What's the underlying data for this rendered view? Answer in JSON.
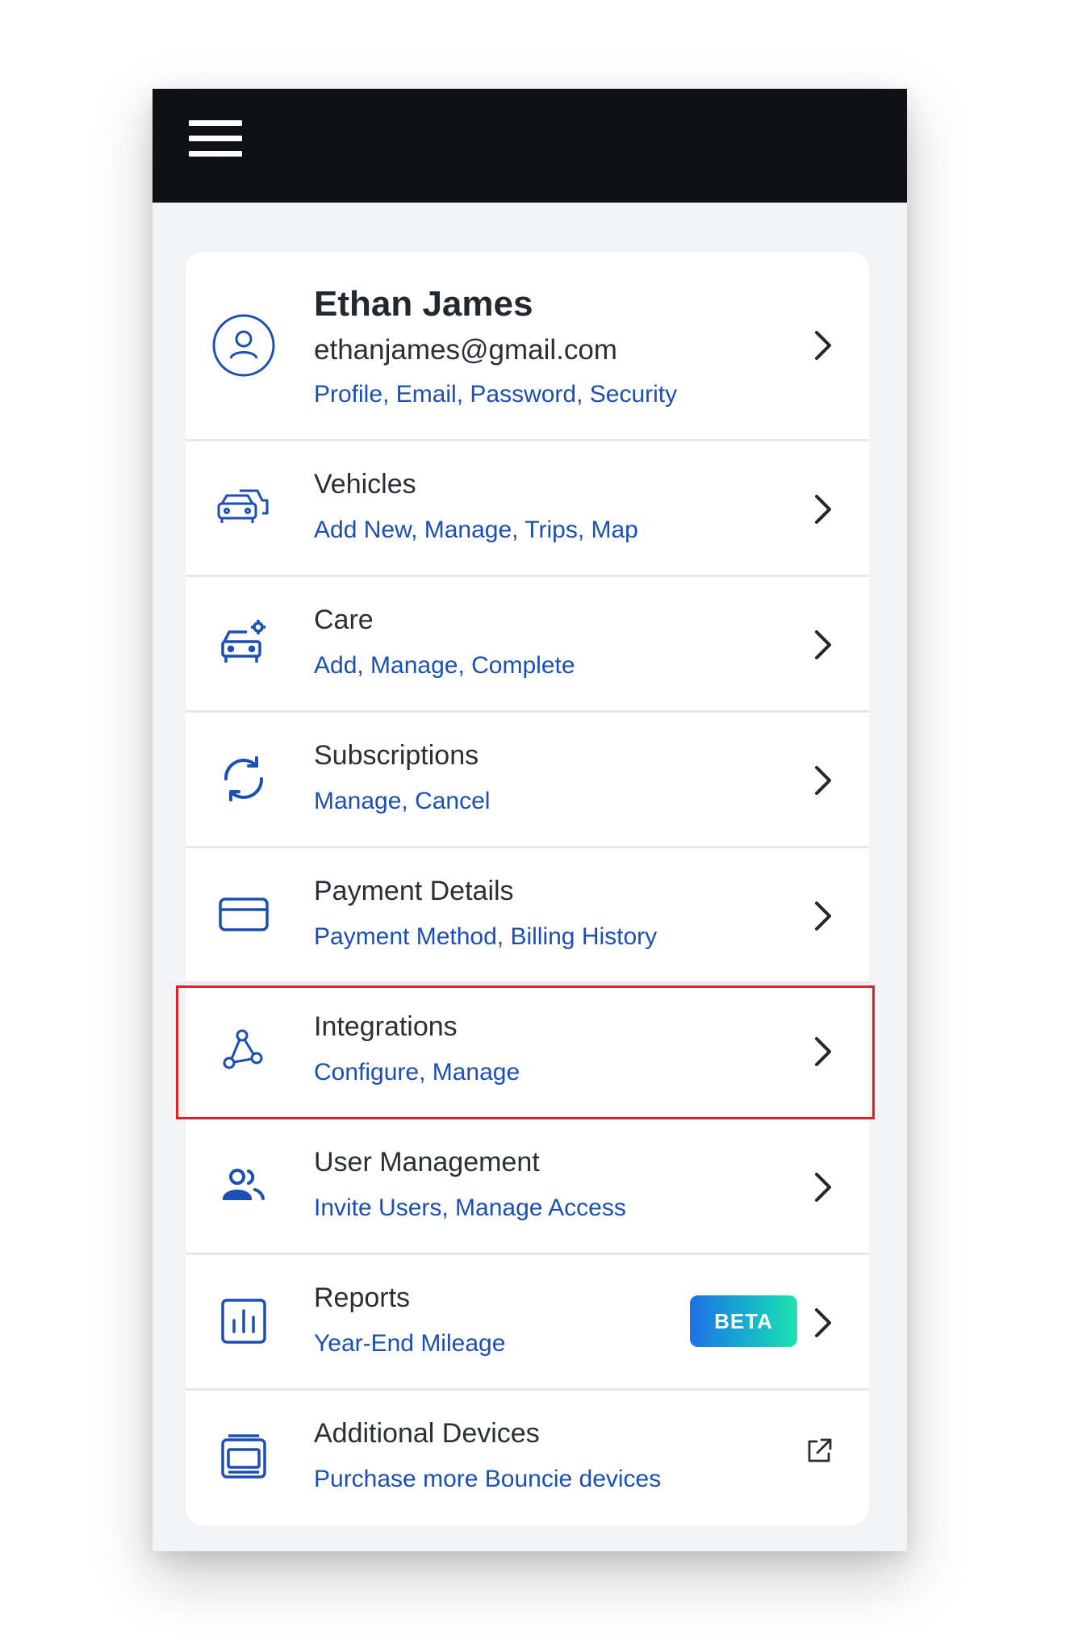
{
  "profile": {
    "name": "Ethan James",
    "email": "ethanjames@gmail.com",
    "subtitle": "Profile, Email, Password, Security"
  },
  "menu": [
    {
      "title": "Vehicles",
      "subtitle": "Add New, Manage, Trips, Map",
      "icon": "vehicles-icon"
    },
    {
      "title": "Care",
      "subtitle": "Add, Manage, Complete",
      "icon": "car-care-icon"
    },
    {
      "title": "Subscriptions",
      "subtitle": "Manage, Cancel",
      "icon": "refresh-icon"
    },
    {
      "title": "Payment Details",
      "subtitle": "Payment Method, Billing History",
      "icon": "credit-card-icon"
    },
    {
      "title": "Integrations",
      "subtitle": "Configure, Manage",
      "icon": "integrations-icon"
    },
    {
      "title": "User Management",
      "subtitle": "Invite Users, Manage Access",
      "icon": "users-icon"
    },
    {
      "title": "Reports",
      "subtitle": "Year-End Mileage",
      "icon": "bar-chart-icon",
      "badge": "BETA"
    },
    {
      "title": "Additional Devices",
      "subtitle": "Purchase more Bouncie devices",
      "icon": "device-icon"
    }
  ],
  "colors": {
    "topbar": "#0e1118",
    "accent_blue": "#1b4fb3",
    "highlight_red": "#e01f26"
  }
}
